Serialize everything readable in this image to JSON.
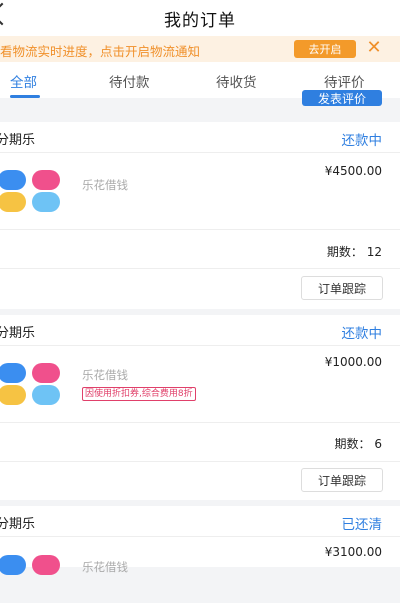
{
  "header": {
    "title": "我的订单"
  },
  "notice": {
    "text": "看物流实时进度，点击开启物流通知",
    "button_label": "去开启",
    "close_icon": "close-icon"
  },
  "tabs": [
    {
      "label": "全部",
      "active": true
    },
    {
      "label": "待付款",
      "active": false
    },
    {
      "label": "待收货",
      "active": false
    },
    {
      "label": "待评价",
      "active": false
    }
  ],
  "partial_button_label": "发表评价",
  "orders": [
    {
      "shop": "分期乐",
      "status": "还款中",
      "product": "乐花借钱",
      "price": "¥4500.00",
      "periods": "期数： 12",
      "track_label": "订单跟踪"
    },
    {
      "shop": "分期乐",
      "status": "还款中",
      "product": "乐花借钱",
      "coupon": "因使用折扣券,综合费用8折",
      "price": "¥1000.00",
      "periods": "期数： 6",
      "track_label": "订单跟踪"
    },
    {
      "shop": "分期乐",
      "status": "已还清",
      "product": "乐花借钱",
      "price": "¥3100.00"
    }
  ],
  "colors": {
    "accent": "#2f7fe0",
    "notice_orange": "#f39a2a",
    "logo": [
      "#3b8ef0",
      "#f0508c",
      "#f6c343",
      "#6ec3f5"
    ]
  }
}
